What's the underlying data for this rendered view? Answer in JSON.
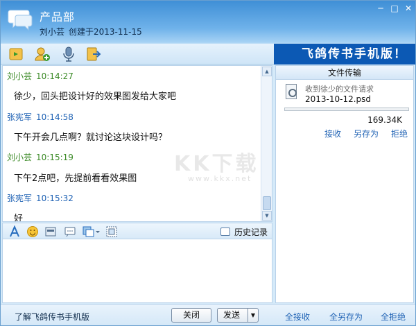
{
  "header": {
    "group_name": "产品部",
    "creator": "刘小芸",
    "created_label": "创建于2013-11-15"
  },
  "window_controls": [
    "minimize-icon",
    "maximize-icon",
    "close-icon"
  ],
  "toolbar": {
    "icons": [
      "share-file-icon",
      "add-member-icon",
      "microphone-icon",
      "exit-group-icon"
    ]
  },
  "banner": {
    "text": "飞鸽传书手机版！"
  },
  "messages": [
    {
      "sender": "刘小芸",
      "time": "10:14:27",
      "text": "徐少，回头把设计好的效果图发给大家吧",
      "color": "#3b8a26"
    },
    {
      "sender": "张宪军",
      "time": "10:14:58",
      "text": "下午开会几点啊？就讨论这块设计吗？",
      "color": "#1f62b4"
    },
    {
      "sender": "刘小芸",
      "time": "10:15:19",
      "text": "下午2点吧，先提前看看效果图",
      "color": "#3b8a26"
    },
    {
      "sender": "张宪军",
      "time": "10:15:32",
      "text": "好",
      "color": "#1f62b4"
    }
  ],
  "format_bar": {
    "icons": [
      "font-icon",
      "emoji-icon",
      "image-icon",
      "screenshot-icon",
      "shake-icon",
      "fullscreen-icon"
    ],
    "history_label": "历史记录"
  },
  "file_panel": {
    "title": "文件传输",
    "note": "收到徐少的文件请求",
    "file_name": "2013-10-12.psd",
    "file_size": "169.34K",
    "progress": 0,
    "actions": {
      "accept": "接收",
      "save_as": "另存为",
      "reject": "拒绝"
    }
  },
  "bottom": {
    "promo_link": "了解飞鸽传书手机版",
    "close_button": "关闭",
    "send_button": "发送",
    "accept_all": "全接收",
    "save_all": "全另存为",
    "reject_all": "全拒绝"
  },
  "watermark": {
    "text": "KK下载",
    "url": "www.kkx.net"
  },
  "colors": {
    "title_gradient_top": "#3f8fd6",
    "banner": "#0c59b4",
    "link": "#1f62b4",
    "sender_green": "#3b8a26"
  }
}
